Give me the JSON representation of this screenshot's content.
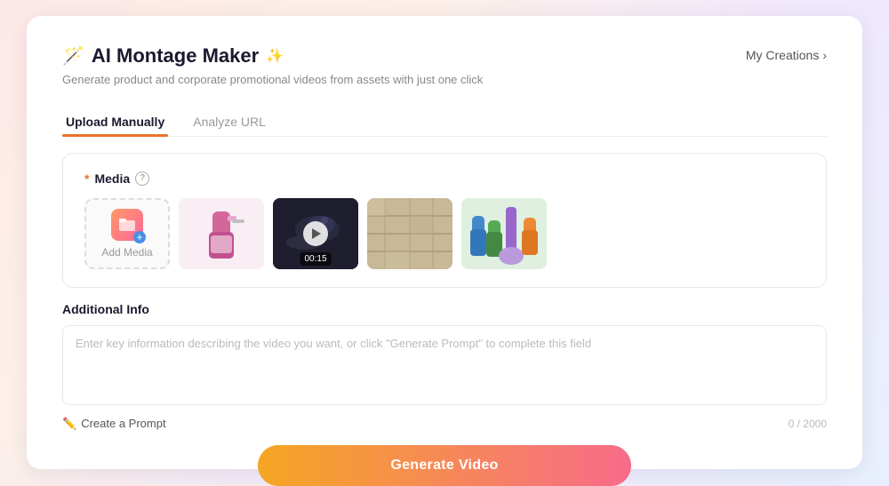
{
  "header": {
    "title": "AI Montage Maker",
    "title_icon": "✨",
    "subtitle": "Generate product and corporate promotional videos from assets with just one click",
    "my_creations_label": "My Creations",
    "my_creations_arrow": "›"
  },
  "tabs": [
    {
      "id": "upload",
      "label": "Upload Manually",
      "active": true
    },
    {
      "id": "url",
      "label": "Analyze URL",
      "active": false
    }
  ],
  "media_section": {
    "label": "Media",
    "required": "*",
    "add_media_label": "Add Media",
    "info_icon_label": "?",
    "thumbnails": [
      {
        "id": 1,
        "type": "image",
        "description": "Pink bottle with spray nozzle"
      },
      {
        "id": 2,
        "type": "video",
        "description": "Dark video frame of lizard/animal",
        "duration": "00:15"
      },
      {
        "id": 3,
        "type": "image",
        "description": "Stone pavement texture"
      },
      {
        "id": 4,
        "type": "image",
        "description": "Cleaning supplies colorful"
      }
    ]
  },
  "additional_info": {
    "label": "Additional Info",
    "placeholder": "Enter key information describing the video you want, or click \"Generate Prompt\" to complete this field",
    "create_prompt_label": "Create a Prompt",
    "char_count": "0 / 2000"
  },
  "generate_button": {
    "label": "Generate Video"
  }
}
